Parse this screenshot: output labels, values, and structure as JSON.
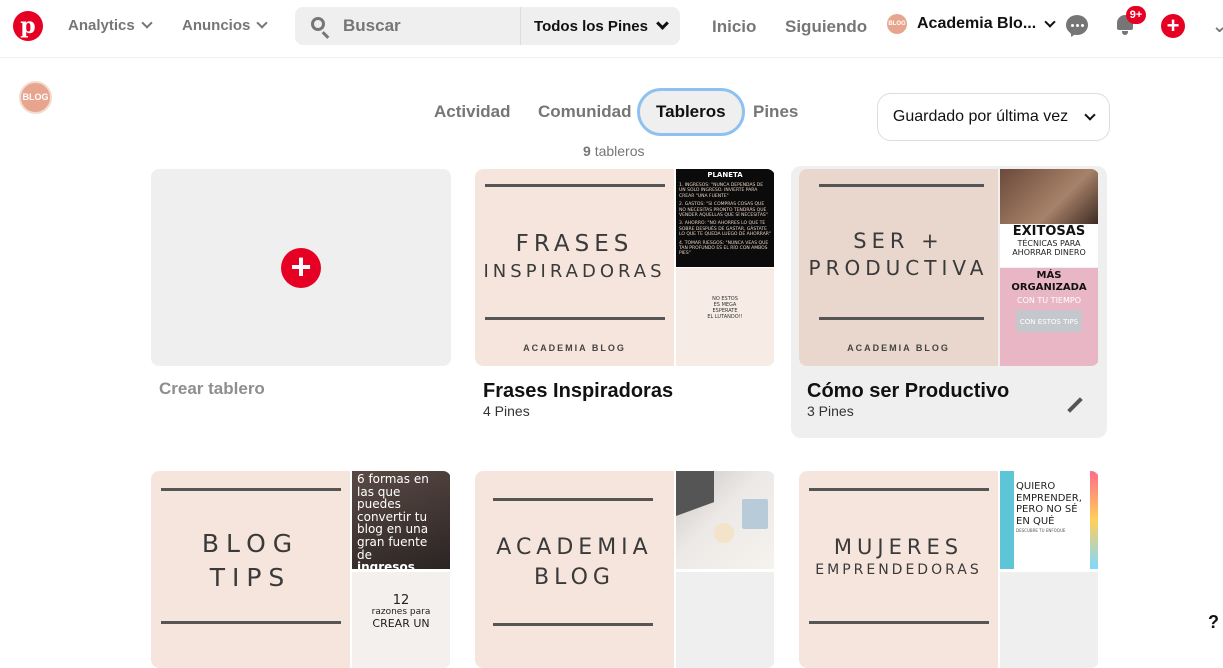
{
  "header": {
    "nav": [
      "Analytics",
      "Anuncios"
    ],
    "search_placeholder": "Buscar",
    "search_scope": "Todos los Pines",
    "links": [
      "Inicio",
      "Siguiendo"
    ],
    "user_name": "Academia Blo...",
    "notification_badge": "9+",
    "avatar_text": "BLOG"
  },
  "tabs": [
    "Actividad",
    "Comunidad",
    "Tableros",
    "Pines"
  ],
  "active_tab": "Tableros",
  "board_count_number": "9",
  "board_count_label": "tableros",
  "sort_label": "Guardado por última vez",
  "create_label": "Crear tablero",
  "boards": [
    {
      "name": "Frases Inspiradoras",
      "pins": "4 Pines",
      "cover": [
        "FRASES",
        "INSPIRADORAS"
      ],
      "cover_footer": "ACADEMIA BLOG",
      "thumb1_title": "PLANETA",
      "thumb1_lines": [
        "1. INGRESOS: \"NUNCA DEPENDAS DE UN SOLO INGRESO. INVIERTE PARA CREAR \"UNA FUENTE\"",
        "2. GASTOS: \"SI COMPRAS COSAS QUE NO NECESITAS PRONTO TENDRÁS QUE VENDER AQUELLAS QUE SÍ NECESITAS\"",
        "3. AHORRO: \"NO AHORRES LO QUE TE SOBRE DESPUÉS DE GASTAR, GÁSTATE LO QUE TE QUEDA LUEGO DE AHORRAR\"",
        "4. TOMAR RIESGOS: \"NUNCA VEAS QUE TAN PROFUNDO ES EL RÍO CON AMBOS PIES\""
      ],
      "thumb2_text": [
        "NO ESTOS",
        "ES MEGA",
        "ESPERATE",
        "EL LUTANDO!!"
      ]
    },
    {
      "name": "Cómo ser Productivo",
      "pins": "3 Pines",
      "cover": [
        "SER +",
        "PRODUCTIVA"
      ],
      "cover_footer": "ACADEMIA BLOG",
      "thumb1_title": "EXITOSAS",
      "thumb1_sub": "TÉCNICAS PARA",
      "thumb1_tail": "AHORRAR DINERO",
      "thumb2_title": [
        "MÁS",
        "ORGANIZADA"
      ],
      "thumb2_sub": "CON TU TIEMPO",
      "thumb2_tail": "CON ESTOS TIPS"
    },
    {
      "cover": [
        "BLOG",
        "TIPS"
      ],
      "thumb1_lines": [
        "6 formas en",
        "las que puedes",
        "convertir tu",
        "blog en una",
        "gran fuente de",
        "ingresos"
      ],
      "thumb2_lines": [
        "12",
        "razones para",
        "CREAR UN"
      ]
    },
    {
      "cover": [
        "ACADEMIA",
        "BLOG"
      ]
    },
    {
      "cover": [
        "MUJERES",
        "EMPRENDEDORAS"
      ],
      "thumb1_lines": [
        "QUIERO",
        "EMPRENDER,",
        "PERO NO SÉ",
        "EN QUÉ"
      ],
      "thumb1_sub": "DESCUBRE TU ENFOQUE"
    }
  ],
  "colors": {
    "brand_red": "#e60023",
    "cover_peach": "#f6e5dc",
    "focus_ring": "#8fc1f0"
  }
}
